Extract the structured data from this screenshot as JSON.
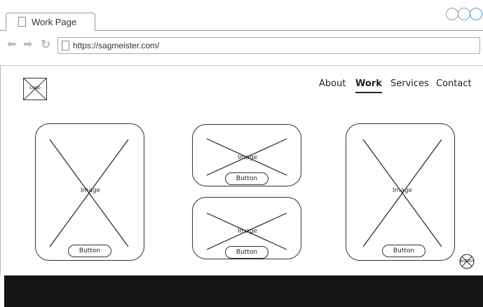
{
  "browser": {
    "tab_title": "Work Page",
    "url": "https://sagmeister.com/",
    "back_icon": "back-arrow-icon",
    "forward_icon": "forward-arrow-icon",
    "reload_icon": "reload-icon"
  },
  "site": {
    "logo_label": "Logo",
    "nav": [
      {
        "label": "About",
        "active": false
      },
      {
        "label": "Work",
        "active": true
      },
      {
        "label": "Services",
        "active": false
      },
      {
        "label": "Contact",
        "active": false
      }
    ],
    "cards": [
      {
        "image_label": "Image",
        "button_label": "Button"
      },
      {
        "image_label": "Image",
        "button_label": "Button"
      },
      {
        "image_label": "Image",
        "button_label": "Button"
      },
      {
        "image_label": "Image",
        "button_label": "Button"
      }
    ],
    "floating_button_label": "Button"
  },
  "colors": {
    "active_window_button": "#3aa0e8",
    "footer": "#141414"
  }
}
